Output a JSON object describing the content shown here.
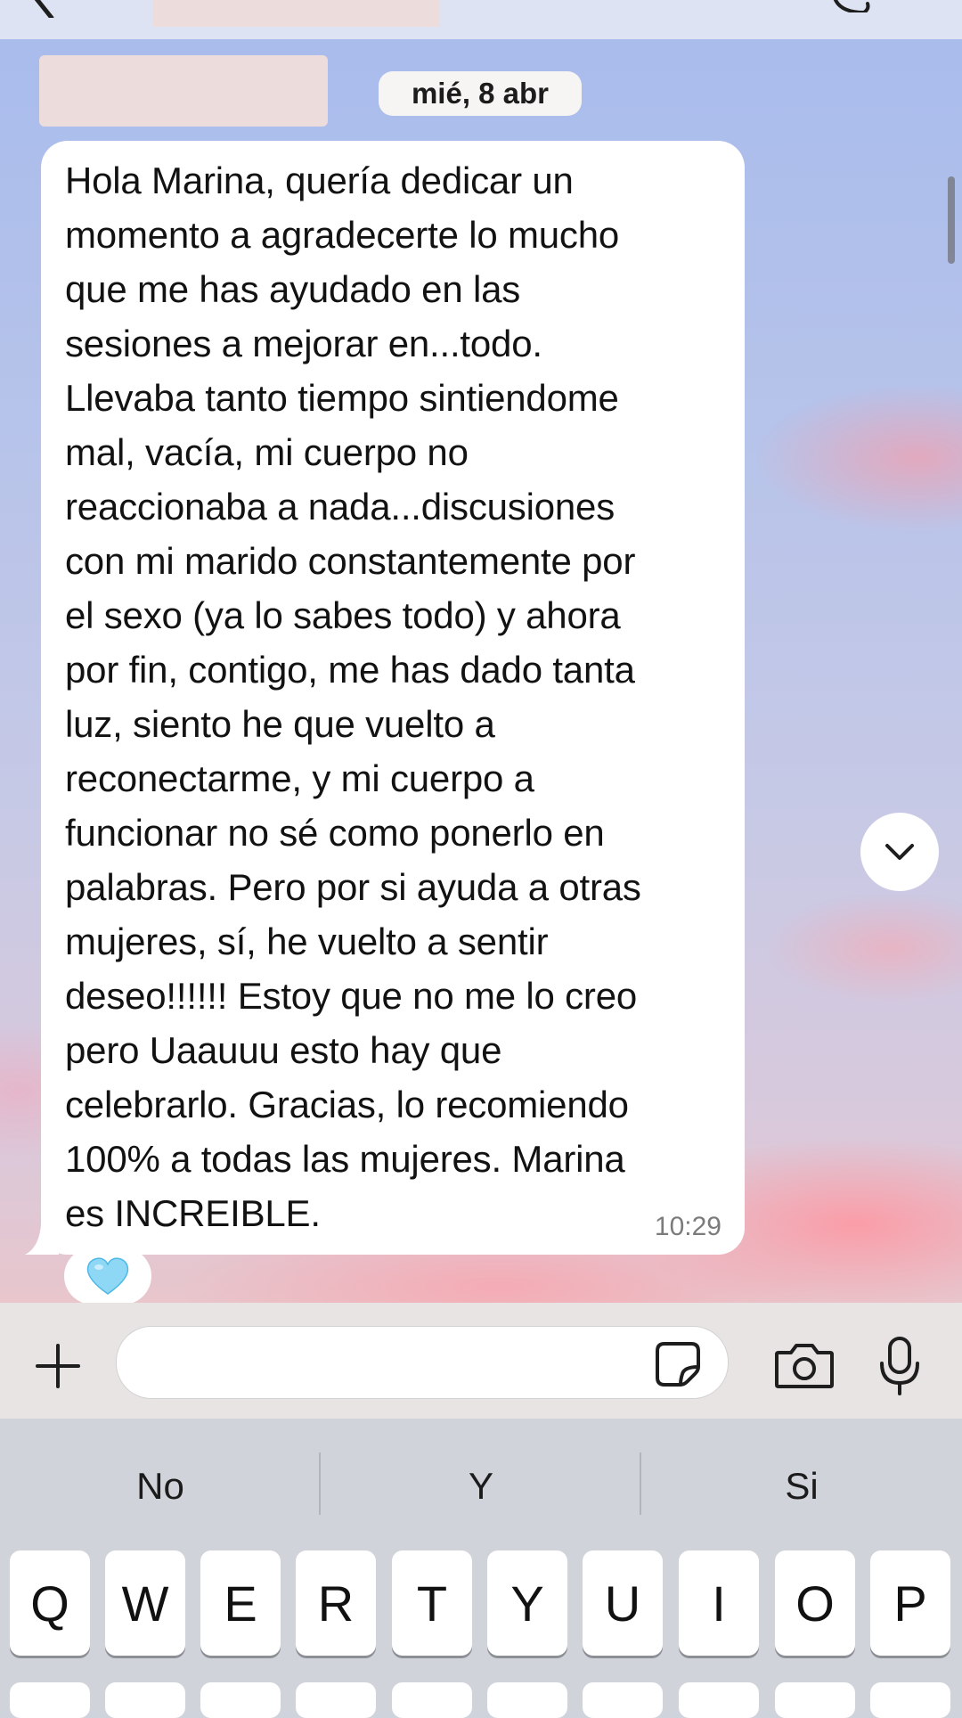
{
  "chat": {
    "date": "mié, 8 abr",
    "message": "Hola Marina, quería dedicar un\nmomento a agradecerte lo mucho\nque me has ayudado en las\nsesiones a mejorar en...todo.\nLlevaba tanto tiempo sintiendome\nmal, vacía, mi cuerpo no\nreaccionaba a nada...discusiones\ncon mi marido constantemente por\nel sexo (ya lo sabes todo) y ahora\npor fin, contigo, me has dado tanta\nluz, siento he que vuelto a\nreconectarme, y mi cuerpo a\nfuncionar no sé como ponerlo en\npalabras. Pero por si ayuda a otras\nmujeres, sí, he vuelto a sentir\ndeseo!!!!!! Estoy que no me lo creo\npero Uaauuu esto hay que\ncelebrarlo. Gracias, lo recomiendo\n100% a todas las mujeres. Marina\nes INCREIBLE.",
    "time": "10:29",
    "reaction": "light-blue-heart",
    "reaction_color": "#7fd3f2"
  },
  "composer": {
    "input_value": ""
  },
  "keyboard": {
    "suggestions": [
      "No",
      "Y",
      "Si"
    ],
    "row1": [
      "Q",
      "W",
      "E",
      "R",
      "T",
      "Y",
      "U",
      "I",
      "O",
      "P"
    ]
  },
  "colors": {
    "bubble": "#ffffff",
    "composer_bg": "#e9e4e4",
    "keyboard_bg": "#d0d3da",
    "redaction": "#eddcdc"
  }
}
